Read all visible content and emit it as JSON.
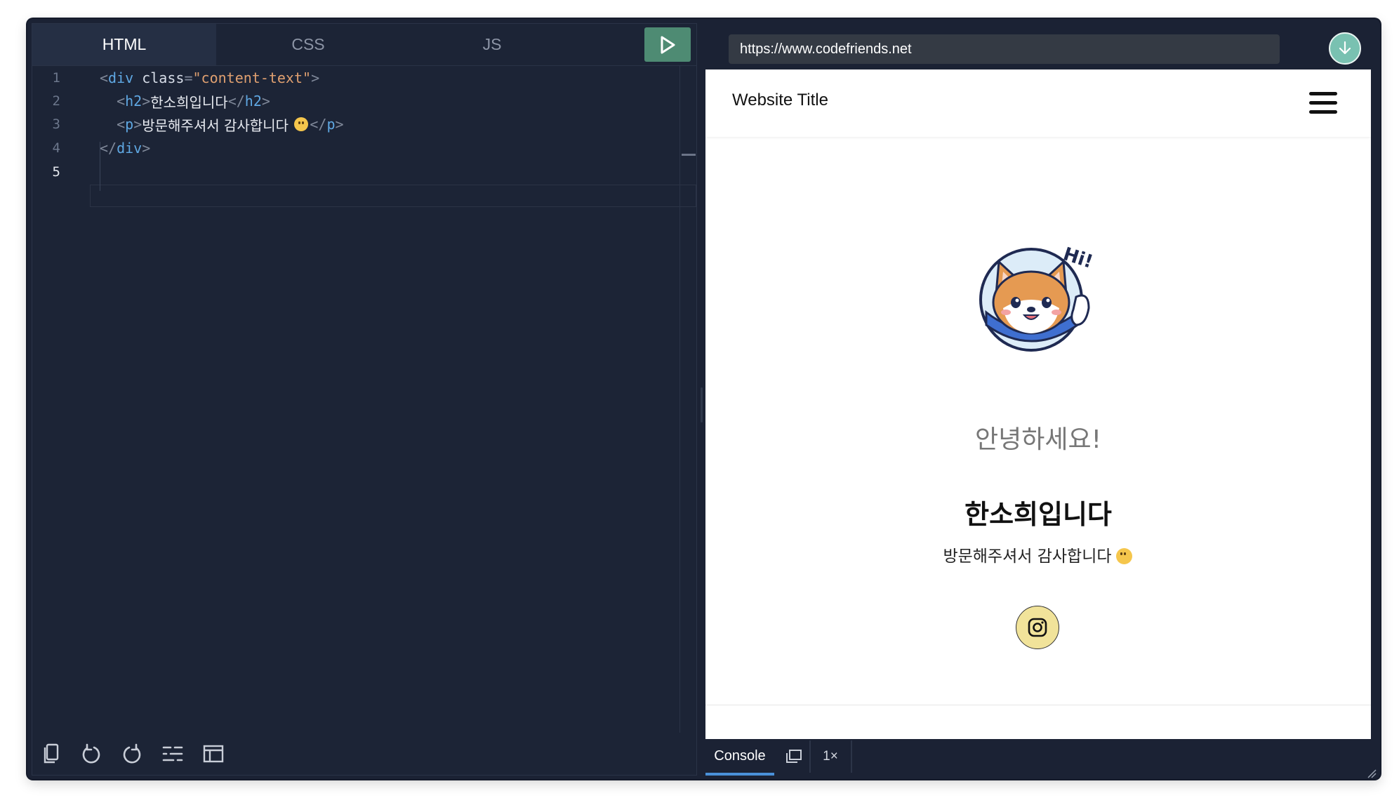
{
  "editor": {
    "tabs": [
      {
        "label": "HTML",
        "active": true
      },
      {
        "label": "CSS",
        "active": false
      },
      {
        "label": "JS",
        "active": false
      }
    ],
    "run_icon": "play-icon",
    "lines": [
      {
        "number": "1",
        "open": "<",
        "tag": "div",
        "attr": "class",
        "eq": "=",
        "value": "\"content-text\"",
        "close": ">"
      },
      {
        "number": "2",
        "indent": "  ",
        "open": "<",
        "tag": "h2",
        "close": ">",
        "text": "한소희입니다",
        "end_open": "</",
        "end_tag": "h2",
        "end_close": ">"
      },
      {
        "number": "3",
        "indent": "  ",
        "open": "<",
        "tag": "p",
        "close": ">",
        "text": "방문해주셔서 감사합니다 ",
        "end_open": "</",
        "end_tag": "p",
        "end_close": ">"
      },
      {
        "number": "4",
        "open": "</",
        "tag": "div",
        "close": ">"
      },
      {
        "number": "5"
      }
    ],
    "toolbar_icons": [
      "copy-icon",
      "undo-icon",
      "redo-icon",
      "format-icon",
      "layout-icon"
    ]
  },
  "preview": {
    "url": "https://www.codefriends.net",
    "download_icon": "download-icon",
    "site_title": "Website Title",
    "menu_icon": "hamburger-icon",
    "avatar_text": "Hi!",
    "greeting": "안녕하세요!",
    "heading": "한소희입니다",
    "paragraph": "방문해주셔서 감사합니다",
    "social_icon": "instagram-icon"
  },
  "console": {
    "tab_label": "Console",
    "popout_icon": "popout-icon",
    "speed": "1×"
  },
  "colors": {
    "editor_bg": "#1c2436",
    "run_button": "#4e8b73",
    "download_button": "#79c1b1",
    "instagram_button": "#f1e39a",
    "tag": "#5fa8e3",
    "string": "#e0a070"
  }
}
